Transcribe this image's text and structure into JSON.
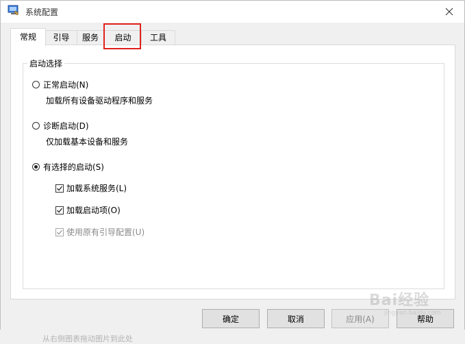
{
  "window": {
    "title": "系统配置"
  },
  "tabs": [
    {
      "label": "常规",
      "active": true
    },
    {
      "label": "引导",
      "active": false
    },
    {
      "label": "服务",
      "active": false
    },
    {
      "label": "启动",
      "active": false,
      "highlighted": true
    },
    {
      "label": "工具",
      "active": false
    }
  ],
  "startup_group": {
    "title": "启动选择",
    "options": [
      {
        "label": "正常启动(N)",
        "description": "加载所有设备驱动程序和服务",
        "selected": false
      },
      {
        "label": "诊断启动(D)",
        "description": "仅加载基本设备和服务",
        "selected": false
      },
      {
        "label": "有选择的启动(S)",
        "selected": true
      }
    ],
    "selective": [
      {
        "label": "加载系统服务(L)",
        "checked": true,
        "enabled": true
      },
      {
        "label": "加载启动项(O)",
        "checked": true,
        "enabled": true
      },
      {
        "label": "使用原有引导配置(U)",
        "checked": true,
        "enabled": false
      }
    ]
  },
  "buttons": {
    "ok": "确定",
    "cancel": "取消",
    "apply": "应用(A)",
    "help": "帮助"
  },
  "watermark": {
    "main": "Bai经验",
    "sub": "jingyan.baidu.com"
  },
  "cut_text": "从右侧图表拖动图片到此处",
  "colors": {
    "highlight": "#e0201b",
    "accent": "#0078d7"
  }
}
